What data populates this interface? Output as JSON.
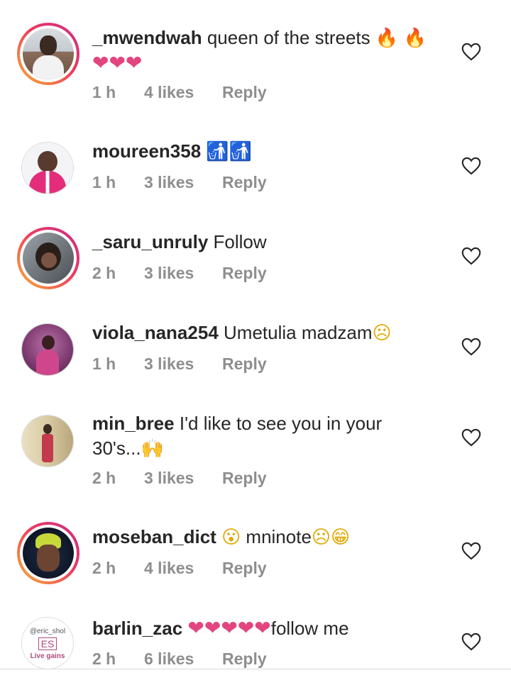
{
  "comments": [
    {
      "username": "_mwendwah",
      "text": "queen of the streets",
      "emoji": "🔥 🔥",
      "line2": "❤❤❤",
      "time": "1 h",
      "likes": "4 likes",
      "reply": "Reply",
      "story": true
    },
    {
      "username": "moureen358",
      "text": "",
      "emoji": "🚮🚮",
      "time": "1 h",
      "likes": "3 likes",
      "reply": "Reply",
      "story": false
    },
    {
      "username": "_saru_unruly",
      "text": "Follow",
      "emoji": "",
      "time": "2 h",
      "likes": "3 likes",
      "reply": "Reply",
      "story": true
    },
    {
      "username": "viola_nana254",
      "text": "Umetulia madzam",
      "emoji": "☹",
      "time": "1 h",
      "likes": "3 likes",
      "reply": "Reply",
      "story": false
    },
    {
      "username": "min_bree",
      "text": "I'd like to see you in your",
      "line2": "30's...",
      "emoji2": "🙌",
      "time": "2 h",
      "likes": "3 likes",
      "reply": "Reply",
      "story": false
    },
    {
      "username": "moseban_dict",
      "text": "mninote",
      "emoji_pre": "😮",
      "emoji": "☹😁",
      "time": "2 h",
      "likes": "4 likes",
      "reply": "Reply",
      "story": true
    },
    {
      "username": "barlin_zac",
      "text": "follow me",
      "emoji_pre": "❤❤❤❤❤",
      "time": "2 h",
      "likes": "6 likes",
      "reply": "Reply",
      "story": false,
      "avatar_text": {
        "top": "@eric_shol",
        "mid": "ES",
        "bottom": "Live gains"
      }
    }
  ],
  "icons": {
    "like": "heart-outline-icon"
  },
  "colors": {
    "heart": "#e2457f",
    "meta": "#8e8e8e",
    "text": "#262626"
  }
}
